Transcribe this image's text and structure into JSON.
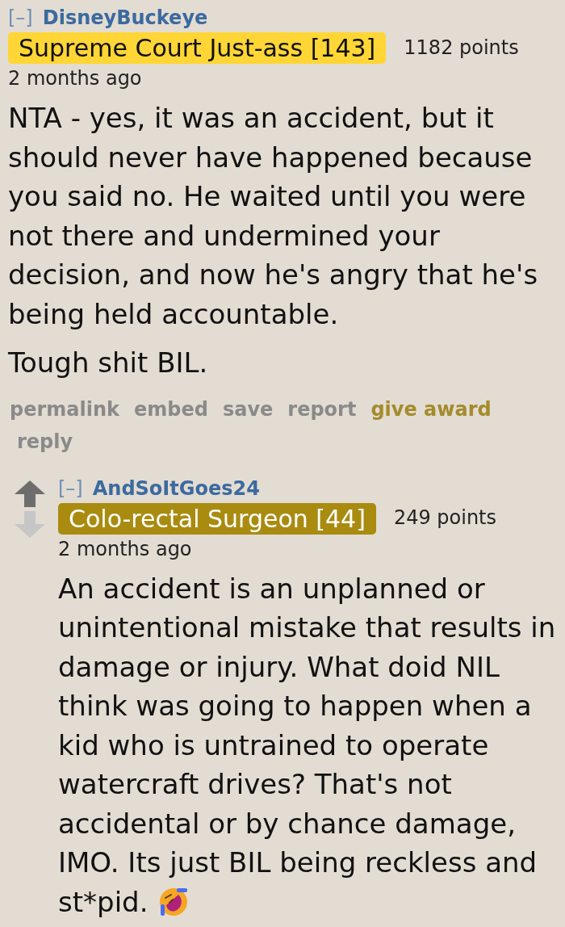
{
  "comments": [
    {
      "collapse": "[–]",
      "author": "DisneyBuckeye",
      "flair": {
        "text": "Supreme Court Just-ass [143]",
        "color": "#ffd635"
      },
      "score": "1182 points",
      "time": "2 months ago",
      "body": [
        "NTA - yes, it was an accident, but it should never have happened because you said no. He waited until you were not there and undermined your decision, and now he's angry that he's being held accountable.",
        "Tough shit BIL."
      ],
      "actions": [
        {
          "label": "permalink",
          "kind": "link"
        },
        {
          "label": "embed",
          "kind": "link"
        },
        {
          "label": "save",
          "kind": "link"
        },
        {
          "label": "report",
          "kind": "link"
        },
        {
          "label": "give award",
          "kind": "award"
        },
        {
          "label": "reply",
          "kind": "link"
        }
      ],
      "children": [
        {
          "upvoted": true,
          "collapse": "[–]",
          "author": "AndSoItGoes24",
          "flair": {
            "text": "Colo-rectal Surgeon [44]",
            "color": "#a98b10"
          },
          "score": "249 points",
          "time": "2 months ago",
          "body": [
            "An accident is an unplanned or unintentional mistake that results in damage or injury. What doid NIL think was going to happen when a kid who is untrained to operate watercraft drives? That's not accidental or by chance damage, IMO. Its just BIL being reckless and st*pid."
          ],
          "emoji": true
        }
      ]
    }
  ]
}
